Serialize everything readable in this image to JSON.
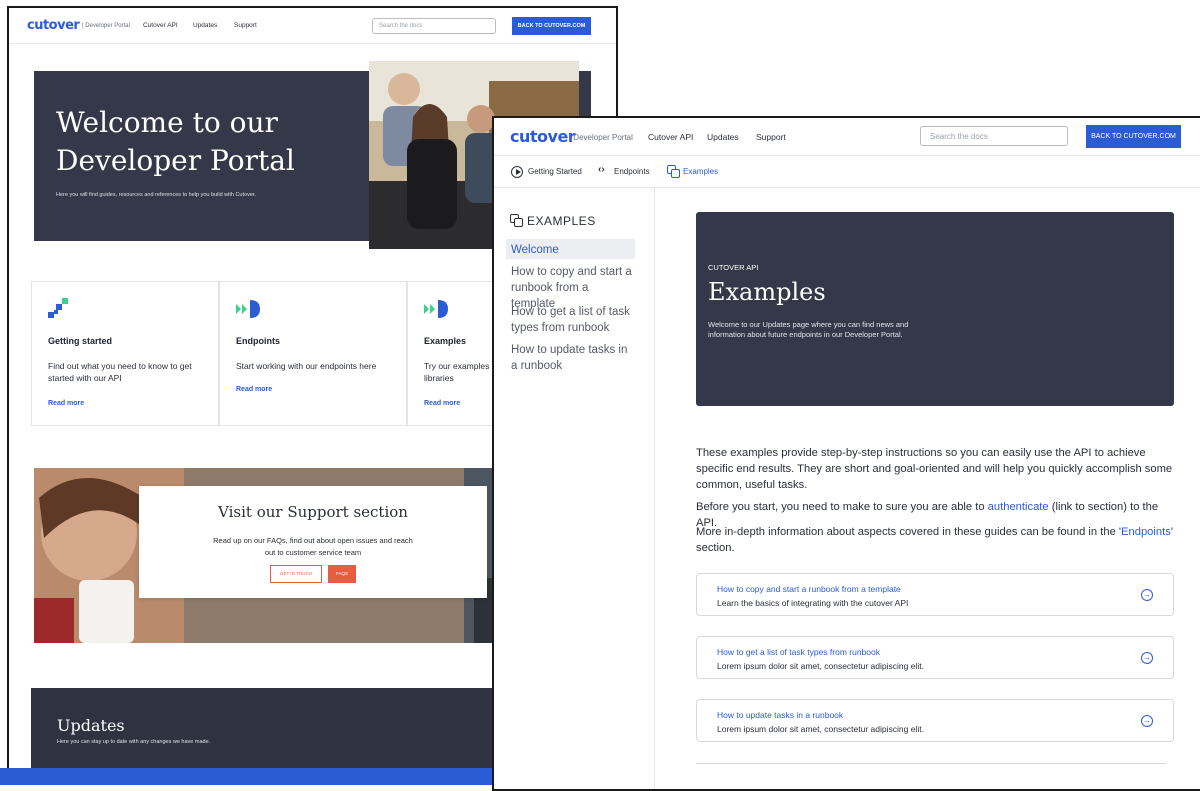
{
  "back": {
    "header": {
      "logo": "cutover",
      "logo_sub": "| Developer Portal",
      "nav": [
        "Cutover API",
        "Updates",
        "Support"
      ],
      "search_placeholder": "Search the docs",
      "cta": "BACK TO CUTOVER.COM"
    },
    "hero": {
      "title_line1": "Welcome to our",
      "title_line2": "Developer Portal",
      "subtitle": "Here you will find guides, resources and references to help you build with Cutover."
    },
    "cards": [
      {
        "title": "Getting started",
        "text": "Find out what you need to know to get started with our API",
        "link": "Read more",
        "icon": "pixel-blocks-icon"
      },
      {
        "title": "Endpoints",
        "text": "Start working with our endpoints here",
        "link": "Read more",
        "icon": "play-arrow-icon"
      },
      {
        "title": "Examples",
        "text": "Try our examples libraries",
        "link": "Read more",
        "icon": "play-arrow-icon"
      }
    ],
    "support": {
      "title": "Visit our Support section",
      "text": "Read up on our FAQs, find out about open issues and reach out to customer service team",
      "btn_contact": "GET IN TOUCH",
      "btn_faqs": "FAQS"
    },
    "updates": {
      "title": "Updates",
      "subtitle": "Here you can stay up to date with any changes we have made."
    }
  },
  "front": {
    "header": {
      "logo": "cutover",
      "logo_sub": "| Developer Portal",
      "nav": [
        "Cutover API",
        "Updates",
        "Support"
      ],
      "search_placeholder": "Search the docs",
      "cta": "BACK TO CUTOVER.COM"
    },
    "subnav": [
      {
        "label": "Getting Started",
        "icon": "play-circle-icon"
      },
      {
        "label": "Endpoints",
        "icon": "code-brackets-icon"
      },
      {
        "label": "Examples",
        "icon": "copy-icon"
      }
    ],
    "sidebar": {
      "heading": "EXAMPLES",
      "items": [
        "Welcome",
        "How to copy and start a runbook from a template",
        "How to get a list of task types from runbook",
        "How to update tasks in a runbook"
      ]
    },
    "hero": {
      "kicker": "CUTOVER API",
      "title": "Examples",
      "text": "Welcome to our Updates page where you can find news and information about future  endpoints in our Developer Portal."
    },
    "intro": "These examples provide step-by-step instructions so you can easily use the API to achieve specific end results. They are short and goal-oriented and will help you quickly accomplish some common, useful tasks.",
    "auth_pre": "Before you start, you need to make to sure you are able to ",
    "auth_link": "authenticate",
    "auth_post": " (link to section) to the API.",
    "more_pre": "More in-depth information about aspects covered in these guides can be found in the '",
    "more_link": "Endpoints",
    "more_post": "' section.",
    "examples": [
      {
        "title": "How to copy and start a runbook from a template",
        "desc": "Learn the basics of integrating with the cutover API"
      },
      {
        "title": "How to get a list of task types from runbook",
        "desc": "Lorem ipsum dolor sit amet, consectetur adipiscing elit."
      },
      {
        "title": "How to update tasks in a runbook",
        "desc": "Lorem ipsum dolor sit amet, consectetur adipiscing elit."
      }
    ]
  }
}
